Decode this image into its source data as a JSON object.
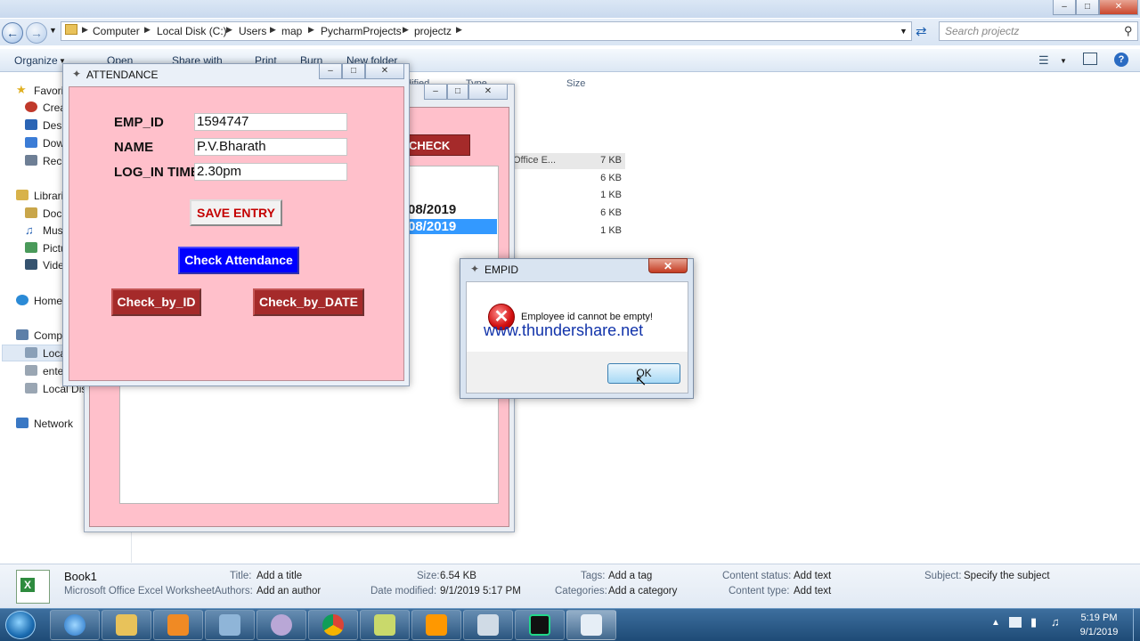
{
  "explorer": {
    "address": {
      "crumbs": [
        "Computer",
        "Local Disk (C:)",
        "Users",
        "map",
        "PycharmProjects",
        "projectz"
      ],
      "search_placeholder": "Search projectz"
    },
    "commands": [
      "Organize",
      "Open",
      "Share with",
      "Print",
      "Burn",
      "New folder"
    ],
    "nav": {
      "items": [
        "Favorites",
        "Crea",
        "Desk",
        "Dow",
        "Rece",
        "Librari",
        "Docu",
        "Mus",
        "Pictu",
        "Vide",
        "Home",
        "Comp",
        "Local",
        "ente",
        "Local Disk",
        "Network"
      ]
    },
    "columns": {
      "modified": "dified",
      "type": "Type",
      "size": "Size"
    },
    "files": [
      {
        "type": "Office E...",
        "size": "7 KB"
      },
      {
        "type": "",
        "size": "6 KB"
      },
      {
        "type": "",
        "size": "1 KB"
      },
      {
        "type": "",
        "size": "6 KB"
      },
      {
        "type": "",
        "size": "1 KB"
      }
    ],
    "details": {
      "name": "Book1",
      "kind": "Microsoft Office Excel Worksheet",
      "title_label": "Title:",
      "title_value": "Add a title",
      "authors_label": "Authors:",
      "authors_value": "Add an author",
      "size_label": "Size:",
      "size_value": "6.54 KB",
      "modified_label": "Date modified:",
      "modified_value": "9/1/2019 5:17 PM",
      "tags_label": "Tags:",
      "tags_value": "Add a tag",
      "categories_label": "Categories:",
      "categories_value": "Add a category",
      "cstatus_label": "Content status:",
      "cstatus_value": "Add text",
      "ctype_label": "Content type:",
      "ctype_value": "Add text",
      "subject_label": "Subject:",
      "subject_value": "Specify the subject"
    }
  },
  "check_window": {
    "check_button": "CHECK",
    "rows": [
      "08/2019",
      "08/2019"
    ]
  },
  "attendance": {
    "title": "ATTENDANCE",
    "emp_id_label": "EMP_ID",
    "emp_id_value": "1594747",
    "name_label": "NAME",
    "name_value": "P.V.Bharath",
    "login_label": "LOG_IN TIME",
    "login_value": "2.30pm",
    "save_button": "SAVE ENTRY",
    "check_attendance_button": "Check Attendance",
    "check_by_id_button": "Check_by_ID",
    "check_by_date_button": "Check_by_DATE"
  },
  "dialog": {
    "title": "EMPID",
    "message": "Employee id cannot be empty!",
    "watermark": "www.thundershare.net",
    "ok_button": "OK"
  },
  "taskbar": {
    "time": "5:19 PM",
    "date": "9/1/2019"
  }
}
